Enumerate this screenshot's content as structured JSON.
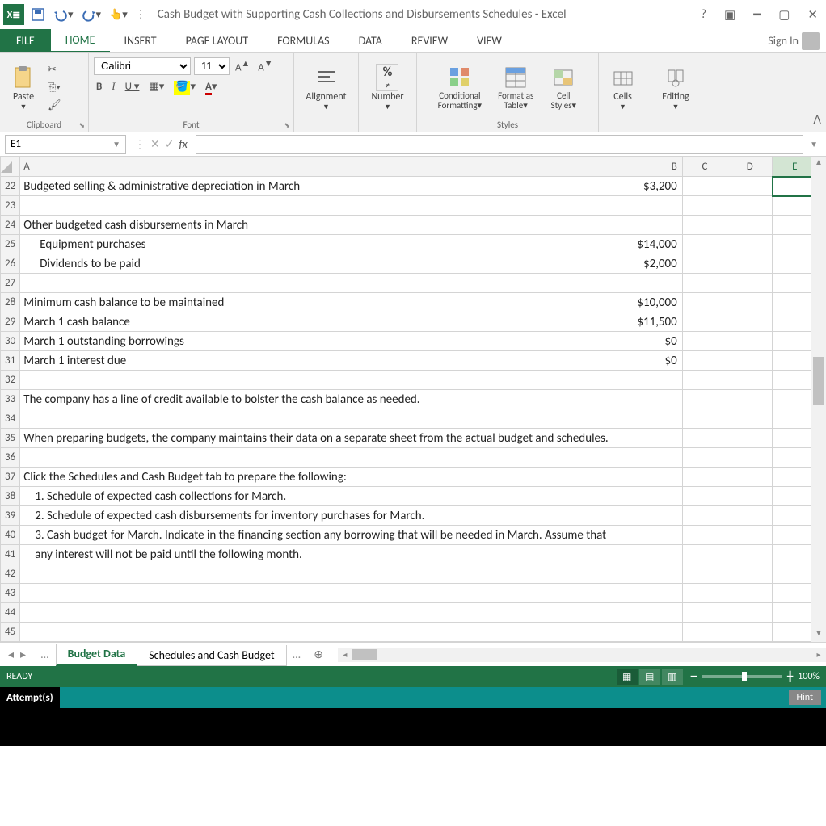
{
  "title": "Cash Budget with Supporting Cash Collections and Disbursements Schedules - Excel",
  "tabs": {
    "file": "FILE",
    "home": "HOME",
    "insert": "INSERT",
    "page_layout": "PAGE LAYOUT",
    "formulas": "FORMULAS",
    "data": "DATA",
    "review": "REVIEW",
    "view": "VIEW"
  },
  "sign_in": "Sign In",
  "ribbon": {
    "clipboard": {
      "paste": "Paste",
      "label": "Clipboard"
    },
    "font": {
      "name": "Calibri",
      "size": "11",
      "label": "Font"
    },
    "alignment": "Alignment",
    "number": "Number",
    "styles": {
      "cond": "Conditional Formatting",
      "fmt_table": "Format as Table",
      "cell_styles": "Cell Styles",
      "label": "Styles"
    },
    "cells": "Cells",
    "editing": "Editing"
  },
  "name_box": "E1",
  "formula_value": "",
  "columns": {
    "A": "A",
    "B": "B",
    "C": "C",
    "D": "D",
    "E": "E"
  },
  "rows": [
    {
      "n": "22",
      "a": "Budgeted selling & administrative depreciation in March",
      "b": "$3,200"
    },
    {
      "n": "23",
      "a": "",
      "b": ""
    },
    {
      "n": "24",
      "a": "Other budgeted cash disbursements in March",
      "b": ""
    },
    {
      "n": "25",
      "a": "Equipment purchases",
      "b": "$14,000",
      "indent": true
    },
    {
      "n": "26",
      "a": "Dividends to be paid",
      "b": "$2,000",
      "indent": true
    },
    {
      "n": "27",
      "a": "",
      "b": ""
    },
    {
      "n": "28",
      "a": "Minimum cash balance to be maintained",
      "b": "$10,000"
    },
    {
      "n": "29",
      "a": "March 1 cash balance",
      "b": "$11,500"
    },
    {
      "n": "30",
      "a": "March 1 outstanding borrowings",
      "b": "$0"
    },
    {
      "n": "31",
      "a": "March 1 interest due",
      "b": "$0"
    },
    {
      "n": "32",
      "a": "",
      "b": ""
    },
    {
      "n": "33",
      "a": "The company has a line of credit available to bolster the cash balance as needed.",
      "b": "",
      "overflow": true
    },
    {
      "n": "34",
      "a": "",
      "b": ""
    },
    {
      "n": "35",
      "a": "When preparing budgets, the company maintains their data on a separate sheet from the actual budget and schedules.",
      "b": "",
      "overflow": true
    },
    {
      "n": "36",
      "a": "",
      "b": ""
    },
    {
      "n": "37",
      "a": "Click the Schedules and Cash Budget tab to prepare the following:",
      "b": "",
      "overflow": true
    },
    {
      "n": "38",
      "a": "1. Schedule of expected cash collections for March.",
      "b": "",
      "indent2": true
    },
    {
      "n": "39",
      "a": "2. Schedule of expected cash disbursements for inventory purchases for March.",
      "b": "",
      "indent2": true,
      "overflow": true
    },
    {
      "n": "40",
      "a": "3. Cash budget for March. Indicate in the financing section any borrowing that will be needed in March.  Assume that",
      "b": "",
      "indent2": true,
      "overflow": true
    },
    {
      "n": "41",
      "a": "any interest will not be paid until the following month.",
      "b": "",
      "indent2": true
    },
    {
      "n": "42",
      "a": "",
      "b": ""
    },
    {
      "n": "43",
      "a": "",
      "b": ""
    },
    {
      "n": "44",
      "a": "",
      "b": ""
    },
    {
      "n": "45",
      "a": "",
      "b": ""
    }
  ],
  "sheet_tabs": {
    "dots": "...",
    "active": "Budget Data",
    "other": "Schedules and Cash Budget"
  },
  "status": {
    "ready": "READY",
    "zoom": "100%"
  },
  "attempts": {
    "label": "Attempt(s)",
    "hint": "Hint"
  }
}
